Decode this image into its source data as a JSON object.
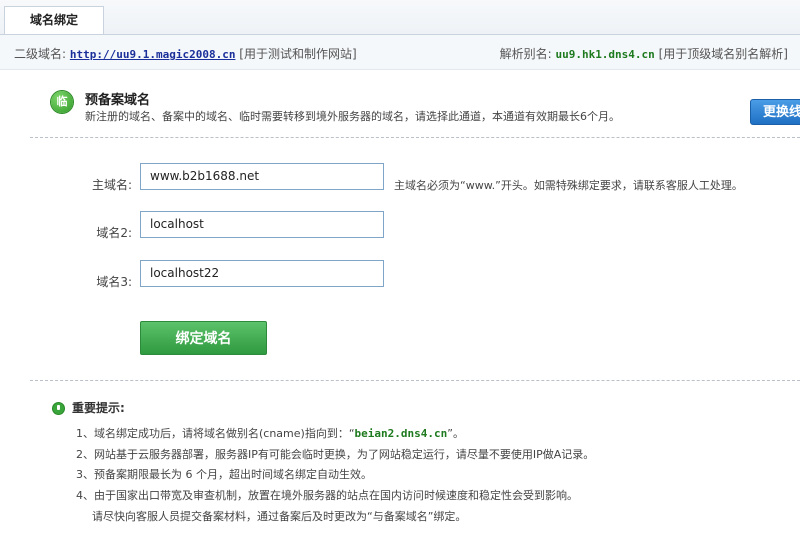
{
  "tab": {
    "label": "域名绑定"
  },
  "info": {
    "subdomain_label": "二级域名:",
    "subdomain_value": "http://uu9.1.magic2008.cn",
    "subdomain_note": "[用于测试和制作网站]",
    "alias_label": "解析别名:",
    "alias_value": "uu9.hk1.dns4.cn",
    "alias_note": "[用于顶级域名别名解析]"
  },
  "section": {
    "icon_text": "临",
    "title": "预备案域名",
    "desc": "新注册的域名、备案中的域名、临时需要转移到境外服务器的域名，请选择此通道，本通道有效期最长6个月。",
    "switch_label": "更换线"
  },
  "form": {
    "main_label": "主域名:",
    "main_value": "www.b2b1688.net",
    "main_hint": "主域名必须为“www.”开头。如需特殊绑定要求，请联系客服人工处理。",
    "domain2_label": "域名2:",
    "domain2_value": "localhost",
    "domain3_label": "域名3:",
    "domain3_value": "localhost22",
    "submit_label": "绑定域名"
  },
  "tips": {
    "title": "重要提示:",
    "t1_prefix": "1、域名绑定成功后，请将域名做别名(cname)指向到：“",
    "t1_value": "beian2.dns4.cn",
    "t1_suffix": "”。",
    "t2": "2、网站基于云服务器部署，服务器IP有可能会临时更换，为了网站稳定运行，请尽量不要使用IP做A记录。",
    "t3": "3、预备案期限最长为 6 个月，超出时间域名绑定自动生效。",
    "t4": "4、由于国家出口带宽及审查机制，放置在境外服务器的站点在国内访问时候速度和稳定性会受到影响。",
    "t5": "请尽快向客服人员提交备案材料，通过备案后及时更改为“与备案域名”绑定。"
  }
}
